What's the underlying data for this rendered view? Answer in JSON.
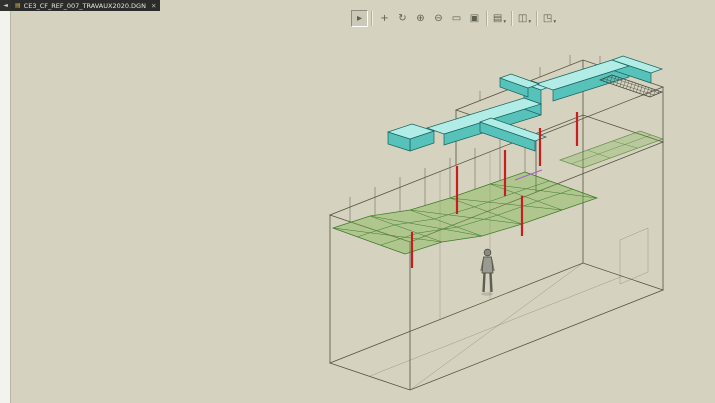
{
  "tab_bar": {
    "app_button_glyph": "◄",
    "tab": {
      "doc_icon": "▤",
      "label": "CE3_CF_REF_007_TRAVAUX2020.DGN",
      "close_glyph": "✕"
    }
  },
  "toolbar": {
    "buttons": [
      {
        "name": "element-selection",
        "glyph": "▸",
        "active": true
      },
      {
        "name": "pan-view",
        "glyph": "+"
      },
      {
        "name": "rotate-view",
        "glyph": "↻"
      },
      {
        "name": "zoom-in",
        "glyph": "⊕"
      },
      {
        "name": "zoom-out",
        "glyph": "⊖"
      },
      {
        "name": "zoom-window",
        "glyph": "▭"
      },
      {
        "name": "fit-view",
        "glyph": "▣"
      },
      {
        "name": "display-style",
        "glyph": "▤"
      },
      {
        "name": "view-orientation",
        "glyph": "◫"
      },
      {
        "name": "copy-view",
        "glyph": "◳"
      }
    ],
    "dropdown_caret": "▾"
  },
  "viewport": {
    "colors": {
      "background": "#d6d2c0",
      "wireframe": "#55543f",
      "ceiling_mesh_fill": "rgba(120,180,70,0.40)",
      "ceiling_mesh_line": "#3f7a28",
      "duct_top": "#b2ece6",
      "duct_side": "#57c2ba",
      "drop_marker": "#c81e1e",
      "figure_body": "#9a9a90",
      "figure_head": "#8a8a80"
    }
  }
}
